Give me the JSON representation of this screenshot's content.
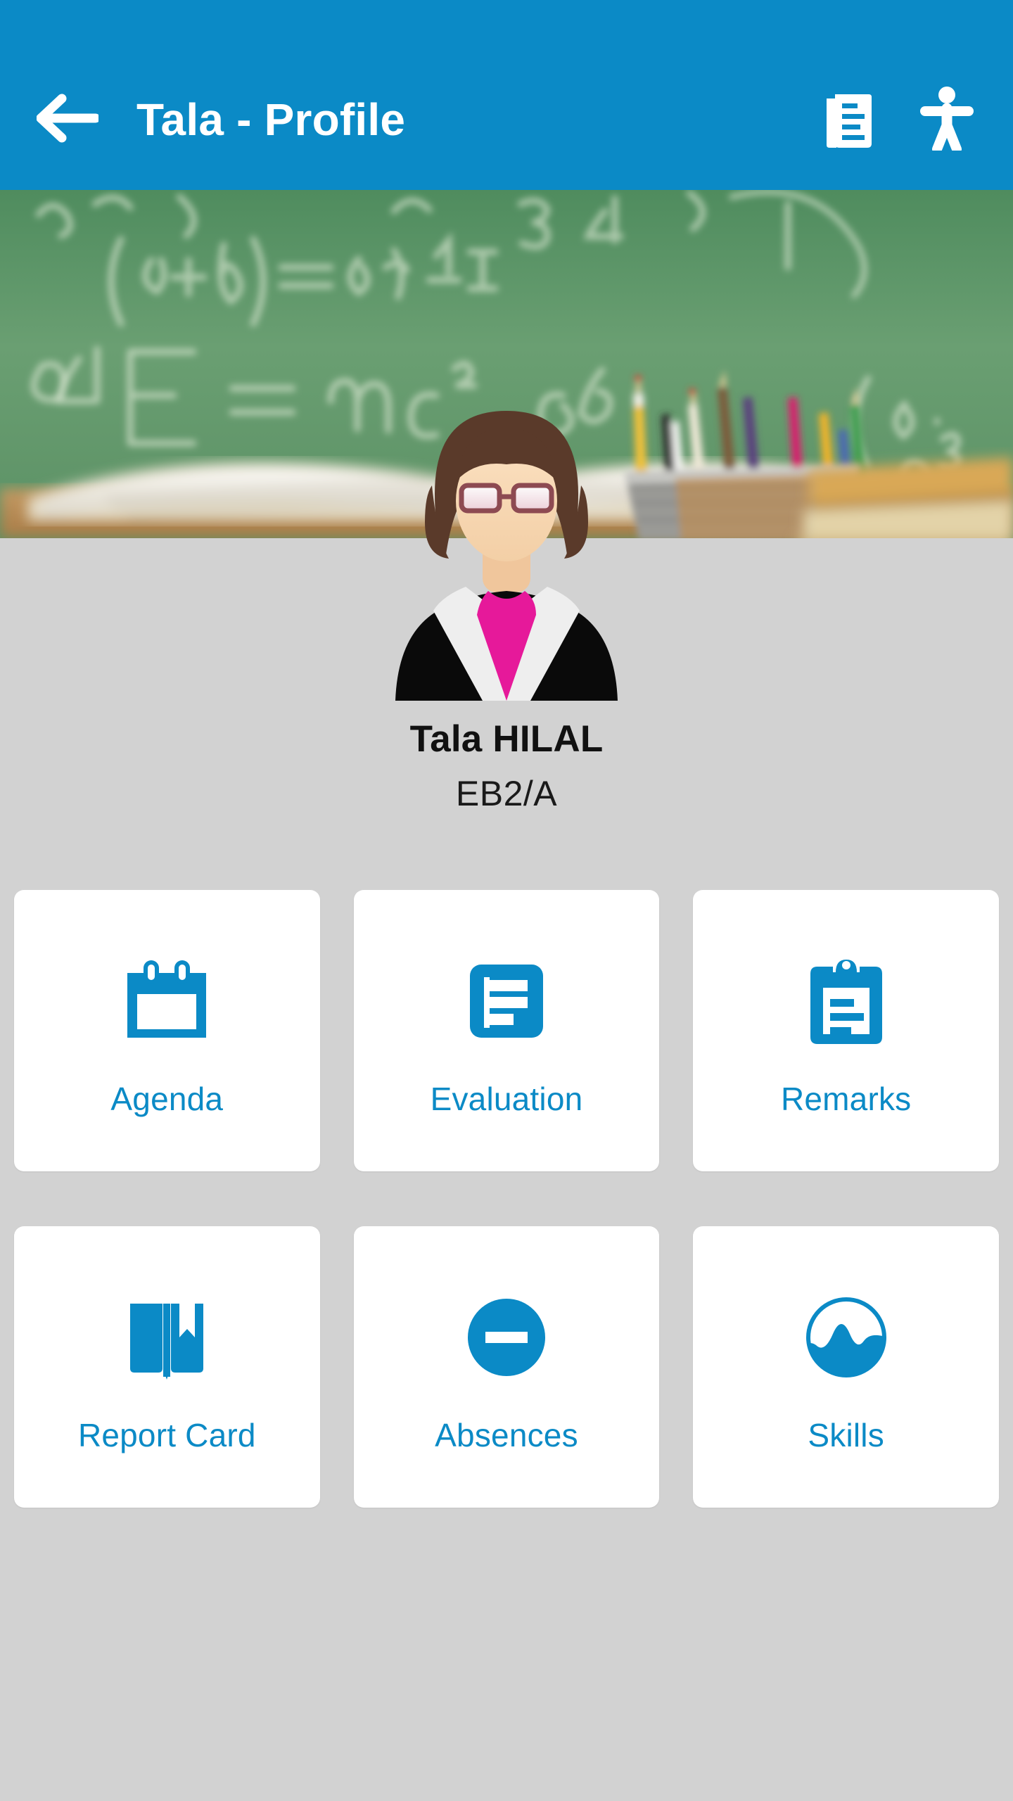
{
  "appbar": {
    "title": "Tala - Profile",
    "back_icon": "arrow-left-icon",
    "actions": [
      {
        "name": "news-document-icon",
        "label": "News"
      },
      {
        "name": "accessibility-person-icon",
        "label": "Accessibility"
      }
    ],
    "background_color": "#0b8ac6",
    "text_color": "#ffffff"
  },
  "banner": {
    "description": "Blurred classroom photo: green chalkboard with math formulas, open book, pencil cup, stacked books",
    "chalk_text": [
      "(a+b)² = a² + ½",
      "E = mc²",
      "(a·b)",
      "3",
      "4",
      "6",
      "0³"
    ]
  },
  "profile": {
    "avatar_icon": "female-teacher-avatar",
    "name": "Tala HILAL",
    "class": "EB2/A"
  },
  "theme": {
    "accent": "#0b8ac6",
    "page_background": "#d2d2d2",
    "card_background": "#ffffff"
  },
  "menu": {
    "tiles": [
      {
        "label": "Agenda",
        "icon": "calendar-icon"
      },
      {
        "label": "Evaluation",
        "icon": "document-lines-icon"
      },
      {
        "label": "Remarks",
        "icon": "clipboard-icon"
      },
      {
        "label": "Report Card",
        "icon": "book-bookmark-icon"
      },
      {
        "label": "Absences",
        "icon": "minus-circle-icon"
      },
      {
        "label": "Skills",
        "icon": "wave-circle-icon"
      }
    ]
  }
}
